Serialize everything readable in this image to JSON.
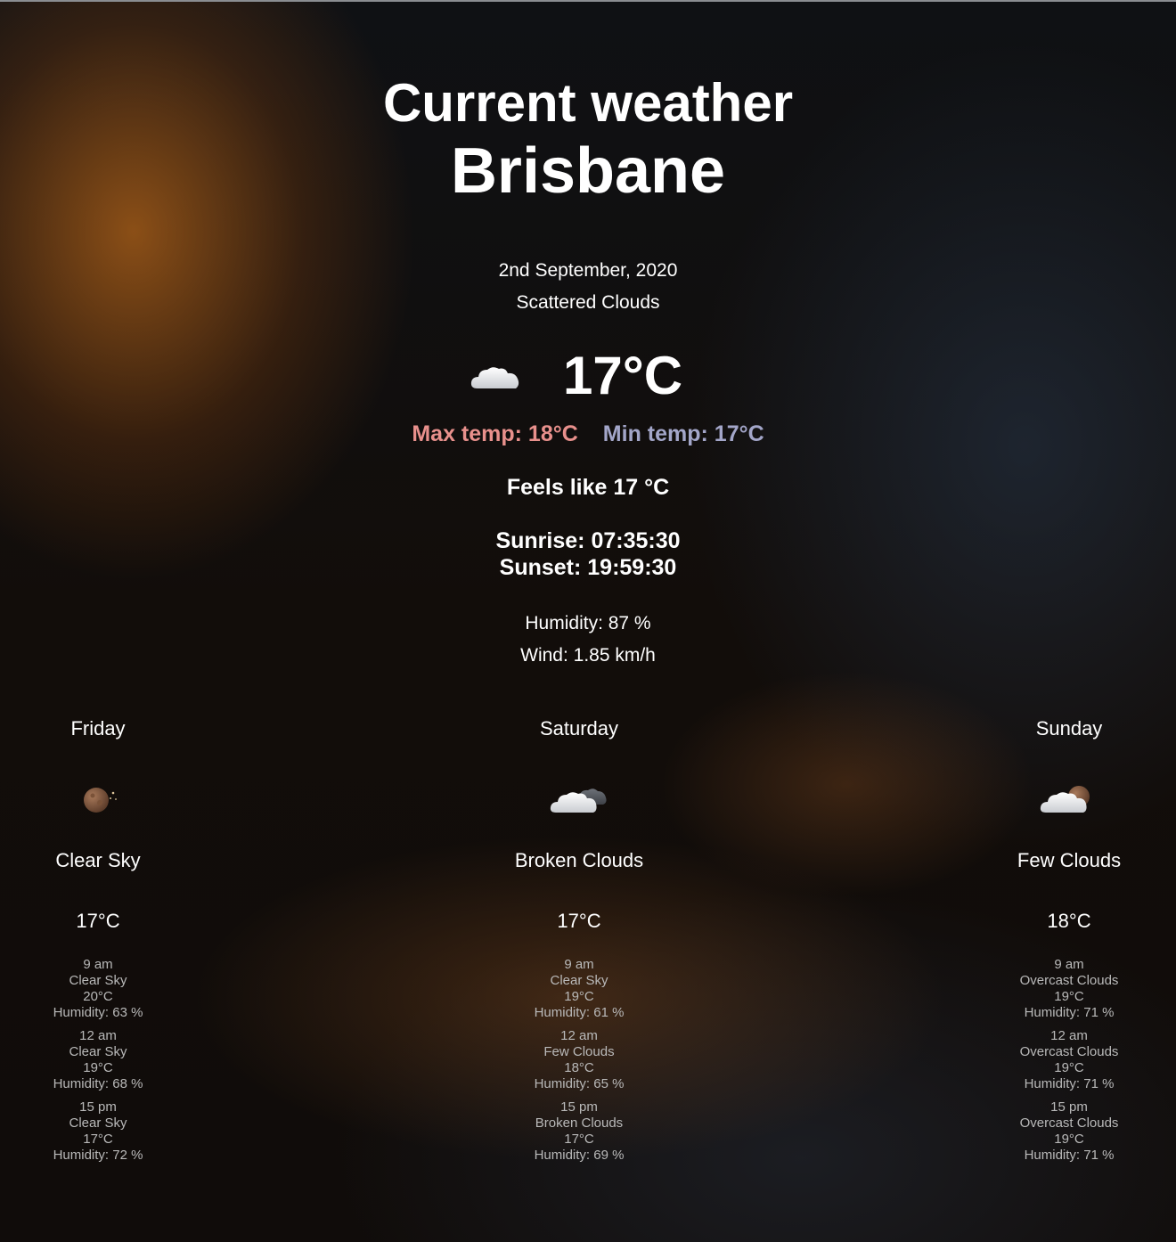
{
  "header": {
    "title": "Current weather",
    "city": "Brisbane"
  },
  "current": {
    "date": "2nd September, 2020",
    "description": "Scattered Clouds",
    "icon": "cloud-icon",
    "temperature": "17°C",
    "max_temp": "Max temp: 18°C",
    "min_temp": "Min temp: 17°C",
    "feels_like": "Feels like 17 °C",
    "sunrise": "Sunrise: 07:35:30",
    "sunset": "Sunset: 19:59:30",
    "humidity": "Humidity: 87 %",
    "wind": "Wind: 1.85 km/h"
  },
  "colors": {
    "max_temp": "#e8908c",
    "min_temp": "#a3a6c9",
    "hourly_text": "#b9b9b9"
  },
  "forecast": [
    {
      "day": "Friday",
      "icon": "moon-icon",
      "description": "Clear Sky",
      "temperature": "17°C",
      "hours": [
        {
          "time": "9 am",
          "description": "Clear Sky",
          "temperature": "20°C",
          "humidity": "Humidity: 63 %"
        },
        {
          "time": "12 am",
          "description": "Clear Sky",
          "temperature": "19°C",
          "humidity": "Humidity: 68 %"
        },
        {
          "time": "15 pm",
          "description": "Clear Sky",
          "temperature": "17°C",
          "humidity": "Humidity: 72 %"
        }
      ]
    },
    {
      "day": "Saturday",
      "icon": "clouds-night-icon",
      "description": "Broken Clouds",
      "temperature": "17°C",
      "hours": [
        {
          "time": "9 am",
          "description": "Clear Sky",
          "temperature": "19°C",
          "humidity": "Humidity: 61 %"
        },
        {
          "time": "12 am",
          "description": "Few Clouds",
          "temperature": "18°C",
          "humidity": "Humidity: 65 %"
        },
        {
          "time": "15 pm",
          "description": "Broken Clouds",
          "temperature": "17°C",
          "humidity": "Humidity: 69 %"
        }
      ]
    },
    {
      "day": "Sunday",
      "icon": "cloud-moon-icon",
      "description": "Few Clouds",
      "temperature": "18°C",
      "hours": [
        {
          "time": "9 am",
          "description": "Overcast Clouds",
          "temperature": "19°C",
          "humidity": "Humidity: 71 %"
        },
        {
          "time": "12 am",
          "description": "Overcast Clouds",
          "temperature": "19°C",
          "humidity": "Humidity: 71 %"
        },
        {
          "time": "15 pm",
          "description": "Overcast Clouds",
          "temperature": "19°C",
          "humidity": "Humidity: 71 %"
        }
      ]
    }
  ]
}
